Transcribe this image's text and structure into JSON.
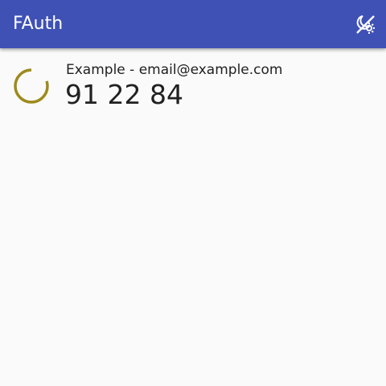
{
  "app": {
    "title": "FAuth"
  },
  "toolbar": {
    "theme_toggle_icon": "theme-toggle-icon"
  },
  "entries": [
    {
      "label": "Example - email@example.com",
      "code": "91 22 84",
      "timer_progress": 0.8,
      "timer_color": "#9e8a1a"
    }
  ],
  "colors": {
    "appbar": "#3f51b5",
    "background": "#fafafa",
    "text": "#212121"
  }
}
